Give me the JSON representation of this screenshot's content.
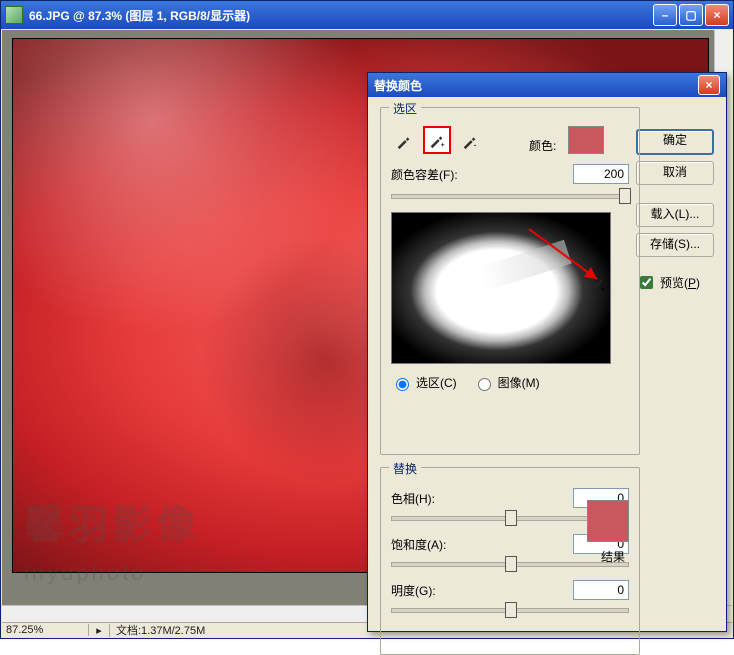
{
  "doc_window": {
    "title": "66.JPG @ 87.3% (图层 1, RGB/8/显示器)",
    "watermark_main": "馨羽影像",
    "watermark_sub": "inyuphoto"
  },
  "statusbar": {
    "zoom": "87.25%",
    "docinfo": "文档:1.37M/2.75M"
  },
  "dialog": {
    "title": "替换颜色",
    "ok": "确定",
    "cancel": "取消",
    "load": "载入(L)...",
    "save": "存储(S)...",
    "preview_label": "预览(P)",
    "preview_label_hotkey": "P",
    "selection_legend": "选区",
    "color_label": "颜色:",
    "color_swatch": "#c9585e",
    "fuzziness_label": "颜色容差(F):",
    "fuzziness_value": "200",
    "radio_selection": "选区(C)",
    "radio_image": "图像(M)",
    "replace_legend": "替换",
    "hue_label": "色相(H):",
    "hue_value": "0",
    "sat_label": "饱和度(A):",
    "sat_value": "0",
    "light_label": "明度(G):",
    "light_value": "0",
    "result_label": "结果",
    "result_swatch": "#c9585e"
  },
  "slider_positions": {
    "fuzziness_pct": 98,
    "hue_pct": 50,
    "sat_pct": 50,
    "light_pct": 50
  }
}
